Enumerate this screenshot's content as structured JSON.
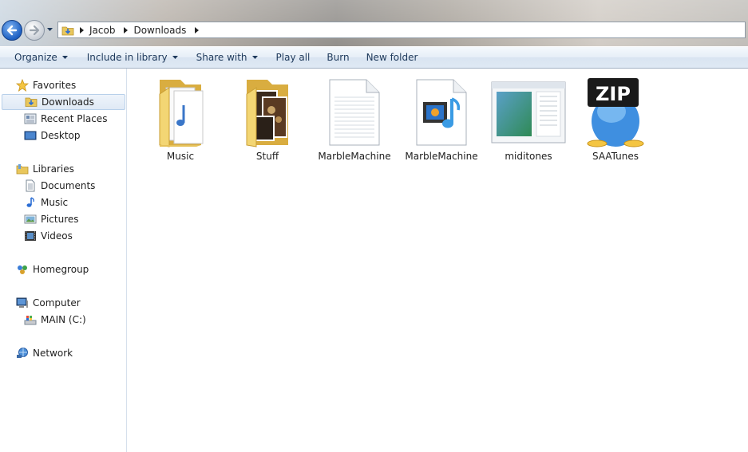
{
  "address": {
    "crumbs": [
      "Jacob",
      "Downloads"
    ]
  },
  "toolbar": {
    "organize": "Organize",
    "include_in_library": "Include in library",
    "share_with": "Share with",
    "play_all": "Play all",
    "burn": "Burn",
    "new_folder": "New folder"
  },
  "sidebar": {
    "favorites": "Favorites",
    "downloads": "Downloads",
    "recent_places": "Recent Places",
    "desktop": "Desktop",
    "libraries": "Libraries",
    "documents": "Documents",
    "music": "Music",
    "pictures": "Pictures",
    "videos": "Videos",
    "homegroup": "Homegroup",
    "computer": "Computer",
    "main_drive": "MAIN (C:)",
    "network": "Network"
  },
  "files": [
    {
      "name": "Music",
      "icon": "music-folder-icon"
    },
    {
      "name": "Stuff",
      "icon": "photo-folder-icon"
    },
    {
      "name": "MarbleMachine",
      "icon": "text-document-icon"
    },
    {
      "name": "MarbleMachine",
      "icon": "media-file-icon"
    },
    {
      "name": "miditones",
      "icon": "application-window-icon"
    },
    {
      "name": "SAATunes",
      "icon": "zip-archive-icon"
    }
  ],
  "zip_label": "ZIP",
  "colors": {
    "accent_blue": "#1d5fc2",
    "folder_yellow": "#f0d36a",
    "command_text": "#1e395b"
  }
}
